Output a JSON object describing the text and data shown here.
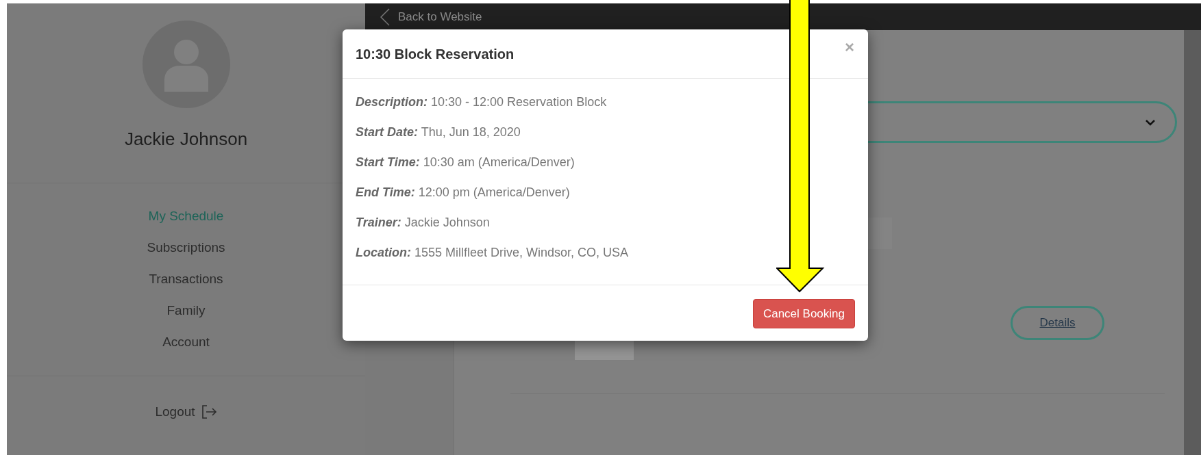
{
  "top_bar": {
    "back_link": "Back to Website"
  },
  "profile": {
    "name": "Jackie Johnson"
  },
  "nav": [
    {
      "label": "My Schedule",
      "selected": true
    },
    {
      "label": "Subscriptions",
      "selected": false
    },
    {
      "label": "Transactions",
      "selected": false
    },
    {
      "label": "Family",
      "selected": false
    },
    {
      "label": "Account",
      "selected": false
    }
  ],
  "logout": {
    "label": "Logout"
  },
  "details_button": {
    "label": "Details"
  },
  "modal": {
    "title": "10:30 Block Reservation",
    "close": "×",
    "fields": [
      {
        "label": "Description:",
        "value": "10:30 - 12:00 Reservation Block"
      },
      {
        "label": "Start Date:",
        "value": "Thu, Jun 18, 2020"
      },
      {
        "label": "Start Time:",
        "value": "10:30 am (America/Denver)"
      },
      {
        "label": "End Time:",
        "value": "12:00 pm (America/Denver)"
      },
      {
        "label": "Trainer:",
        "value": "Jackie Johnson"
      },
      {
        "label": "Location:",
        "value": "1555 Millfleet Drive, Windsor, CO, USA"
      }
    ],
    "action": "Cancel Booking"
  }
}
